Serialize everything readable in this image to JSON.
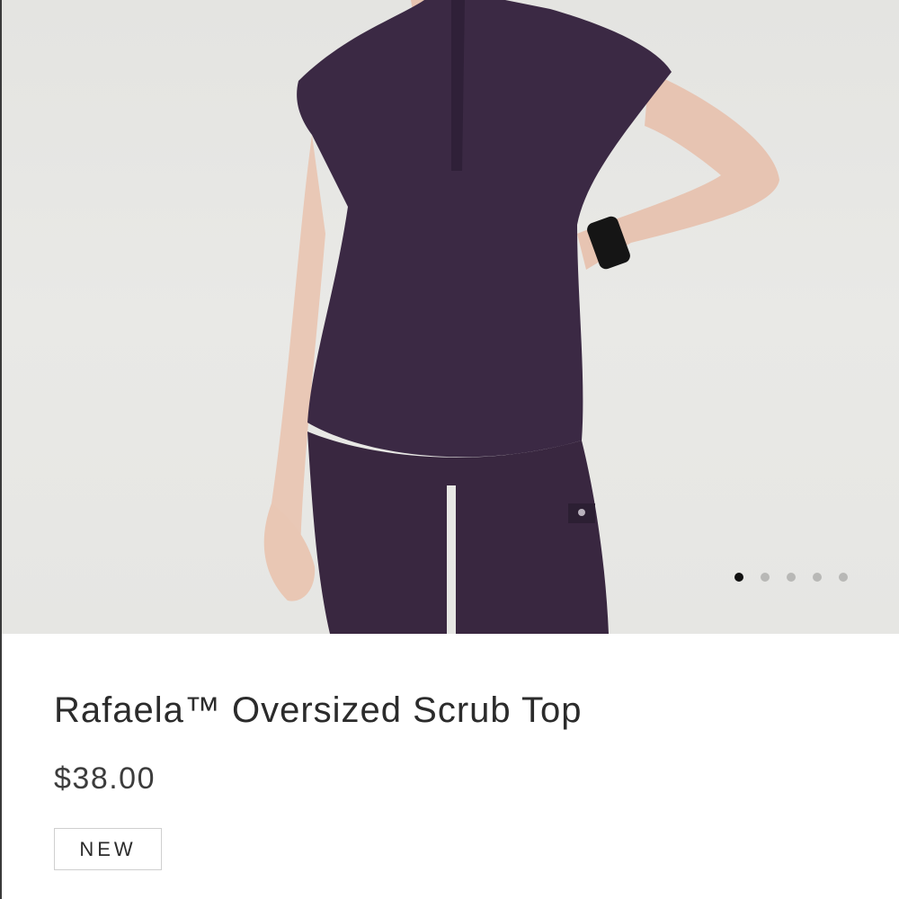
{
  "product": {
    "name": "Rafaela™ Oversized Scrub Top",
    "price": "$38.00",
    "badge": "NEW",
    "image_alt": "Model wearing purple oversized scrub top with matching scrub pants"
  },
  "carousel": {
    "active_index": 0,
    "total": 5
  },
  "colors": {
    "garment": "#3a2843",
    "background": "#e7e7e4",
    "dot_active": "#111111",
    "dot_inactive": "#b8b8b6"
  }
}
